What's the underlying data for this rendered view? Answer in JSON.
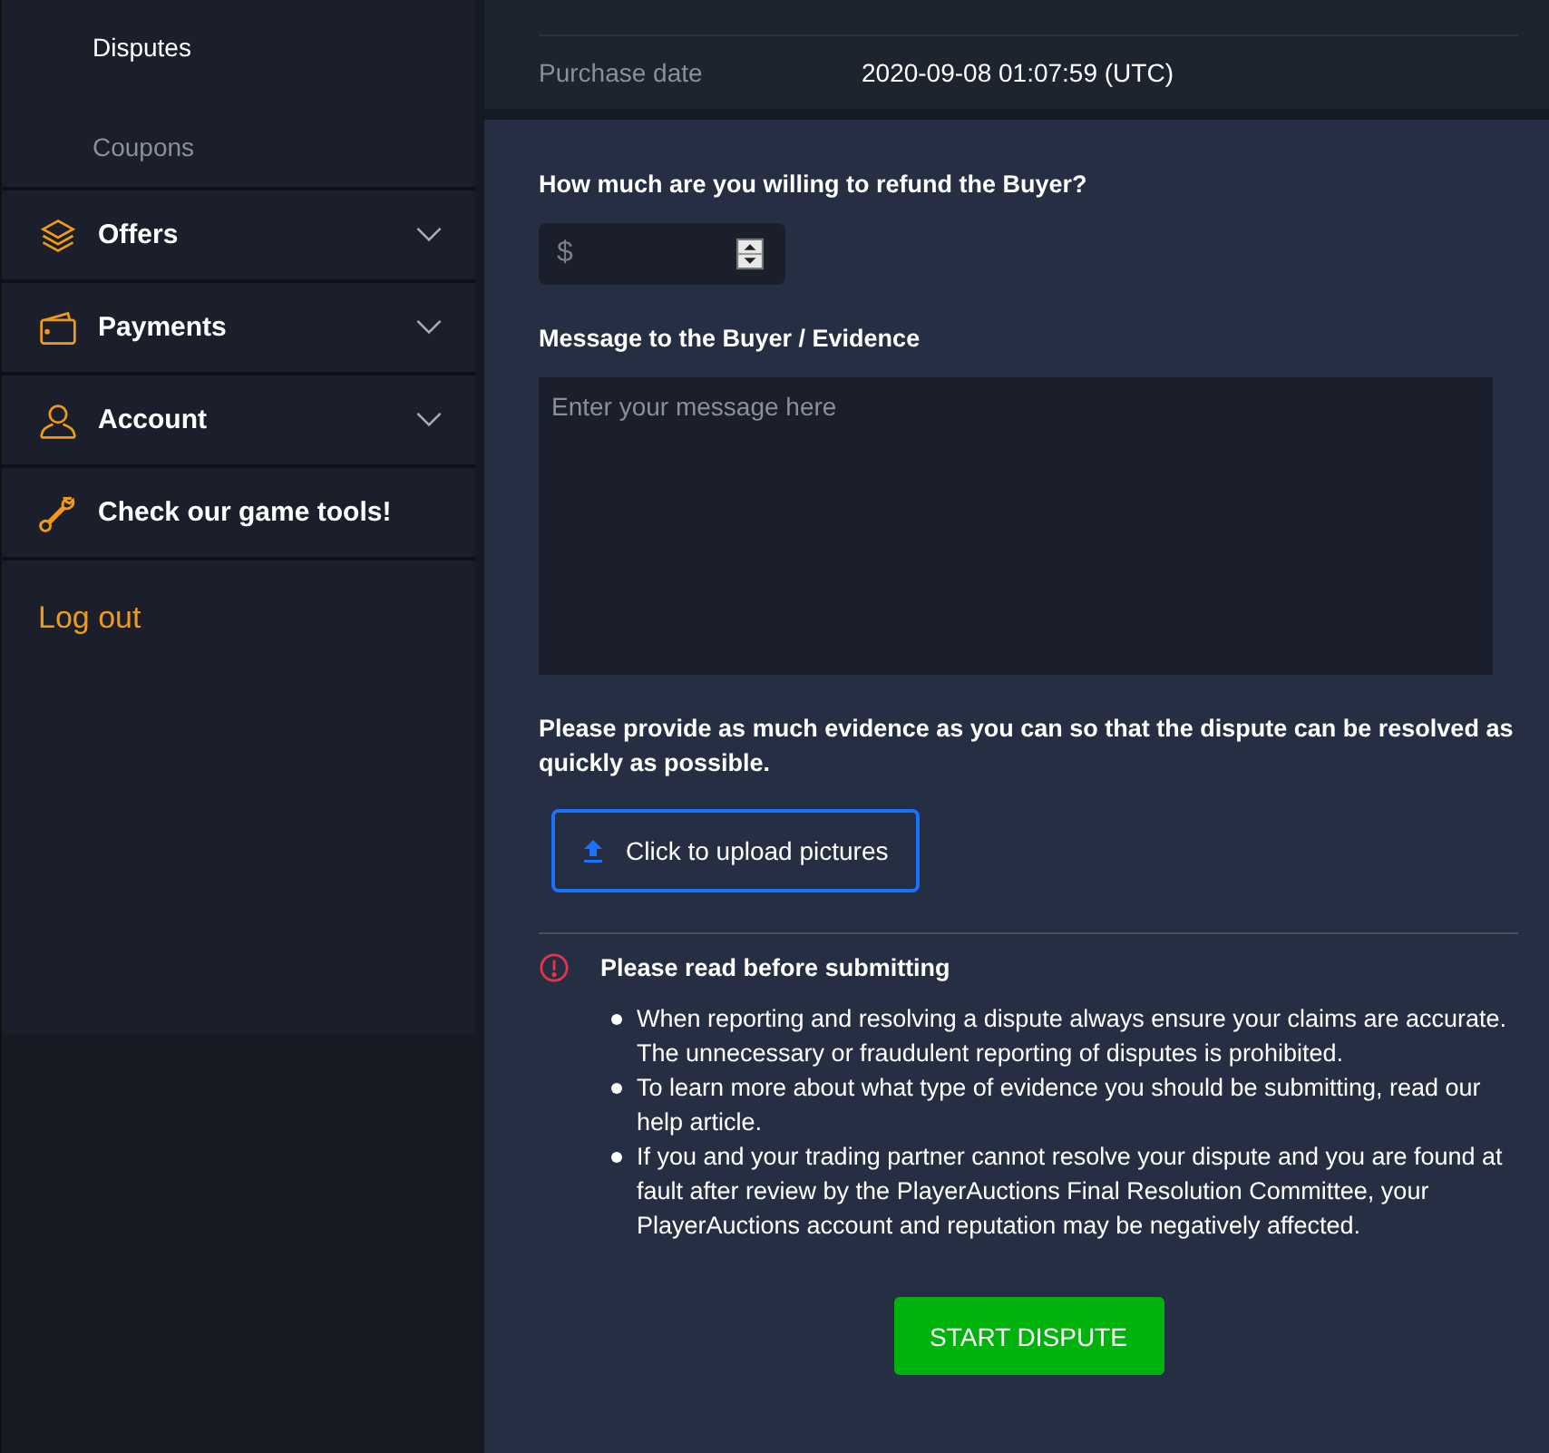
{
  "sidebar": {
    "subitems": [
      {
        "label": "Disputes",
        "selected": true
      },
      {
        "label": "Coupons",
        "selected": false
      }
    ],
    "sections": [
      {
        "label": "Offers",
        "expanded": false
      },
      {
        "label": "Payments",
        "expanded": false
      },
      {
        "label": "Account",
        "expanded": false
      },
      {
        "label": "Check our game tools!"
      }
    ],
    "logout": "Log out"
  },
  "order_details": [
    {
      "label": "Purchase date",
      "value": "2020-09-08 01:07:59 (UTC)"
    }
  ],
  "form": {
    "refund_label": "How much are you willing to refund the Buyer?",
    "refund_placeholder": "$",
    "message_label": "Message to the Buyer / Evidence",
    "message_placeholder": "Enter your message here",
    "evidence_note": "Please provide as much evidence as you can so that the dispute can be resolved as quickly as possible.",
    "upload_button": "Click to upload pictures",
    "notice_title": "Please read before submitting",
    "notice_items": [
      "When reporting and resolving a dispute always ensure your claims are accurate. The unnecessary or fraudulent reporting of disputes is prohibited.",
      "To learn more about what type of evidence you should be submitting, read our help article.",
      "If you and your trading partner cannot resolve your dispute and you are found at fault after review by the PlayerAuctions Final Resolution Committee, your PlayerAuctions account and reputation may be negatively affected."
    ],
    "submit_button": "START DISPUTE"
  }
}
